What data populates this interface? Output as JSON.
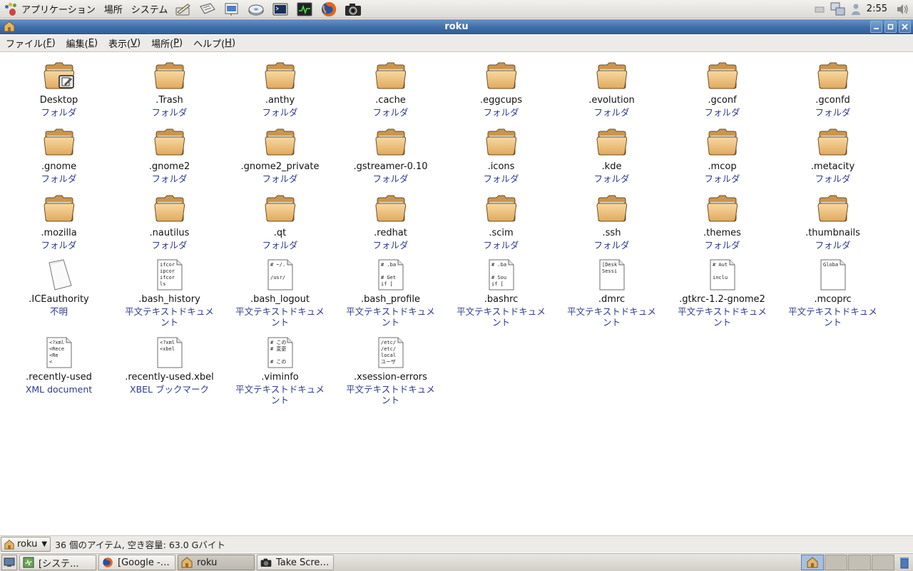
{
  "top_panel": {
    "applications_label": "アプリケーション",
    "places_label": "場所",
    "system_label": "システム",
    "launchers": [
      {
        "icon": "pen-drawing-icon"
      },
      {
        "icon": "text-editor-icon"
      },
      {
        "icon": "presentation-icon"
      },
      {
        "icon": "disk-icon"
      },
      {
        "icon": "terminal-icon"
      },
      {
        "icon": "system-monitor-icon"
      },
      {
        "icon": "firefox-icon"
      },
      {
        "icon": "camera-icon"
      }
    ],
    "clock": "2:55"
  },
  "window": {
    "title": "roku"
  },
  "menubar": {
    "items": [
      {
        "label": "ファイル(",
        "accel": "F",
        "close": ")"
      },
      {
        "label": "編集(",
        "accel": "E",
        "close": ")"
      },
      {
        "label": "表示(",
        "accel": "V",
        "close": ")"
      },
      {
        "label": "場所(",
        "accel": "P",
        "close": ")"
      },
      {
        "label": "ヘルプ(",
        "accel": "H",
        "close": ")"
      }
    ]
  },
  "icons": [
    {
      "name": "Desktop",
      "type": "フォルダ",
      "kind": "desktop-folder"
    },
    {
      "name": ".Trash",
      "type": "フォルダ",
      "kind": "folder"
    },
    {
      "name": ".anthy",
      "type": "フォルダ",
      "kind": "folder"
    },
    {
      "name": ".cache",
      "type": "フォルダ",
      "kind": "folder"
    },
    {
      "name": ".eggcups",
      "type": "フォルダ",
      "kind": "folder"
    },
    {
      "name": ".evolution",
      "type": "フォルダ",
      "kind": "folder"
    },
    {
      "name": ".gconf",
      "type": "フォルダ",
      "kind": "folder"
    },
    {
      "name": ".gconfd",
      "type": "フォルダ",
      "kind": "folder"
    },
    {
      "name": ".gnome",
      "type": "フォルダ",
      "kind": "folder"
    },
    {
      "name": ".gnome2",
      "type": "フォルダ",
      "kind": "folder"
    },
    {
      "name": ".gnome2_private",
      "type": "フォルダ",
      "kind": "folder"
    },
    {
      "name": ".gstreamer-0.10",
      "type": "フォルダ",
      "kind": "folder"
    },
    {
      "name": ".icons",
      "type": "フォルダ",
      "kind": "folder"
    },
    {
      "name": ".kde",
      "type": "フォルダ",
      "kind": "folder"
    },
    {
      "name": ".mcop",
      "type": "フォルダ",
      "kind": "folder"
    },
    {
      "name": ".metacity",
      "type": "フォルダ",
      "kind": "folder"
    },
    {
      "name": ".mozilla",
      "type": "フォルダ",
      "kind": "folder"
    },
    {
      "name": ".nautilus",
      "type": "フォルダ",
      "kind": "folder"
    },
    {
      "name": ".qt",
      "type": "フォルダ",
      "kind": "folder"
    },
    {
      "name": ".redhat",
      "type": "フォルダ",
      "kind": "folder"
    },
    {
      "name": ".scim",
      "type": "フォルダ",
      "kind": "folder"
    },
    {
      "name": ".ssh",
      "type": "フォルダ",
      "kind": "folder"
    },
    {
      "name": ".themes",
      "type": "フォルダ",
      "kind": "folder"
    },
    {
      "name": ".thumbnails",
      "type": "フォルダ",
      "kind": "folder"
    },
    {
      "name": ".ICEauthority",
      "type": "不明",
      "kind": "blank-file"
    },
    {
      "name": ".bash_history",
      "type": "平文テキストドキュメント",
      "kind": "text-file",
      "preview": [
        "ifcor",
        "ipcor",
        "ifcor",
        "ls"
      ]
    },
    {
      "name": ".bash_logout",
      "type": "平文テキストドキュメント",
      "kind": "text-file",
      "preview": [
        "# ~/.",
        "",
        "/usr/",
        ""
      ]
    },
    {
      "name": ".bash_profile",
      "type": "平文テキストドキュメント",
      "kind": "text-file",
      "preview": [
        "# .ba",
        "",
        "# Get",
        "if ["
      ]
    },
    {
      "name": ".bashrc",
      "type": "平文テキストドキュメント",
      "kind": "text-file",
      "preview": [
        "# .ba",
        "",
        "# Sou",
        "if ["
      ]
    },
    {
      "name": ".dmrc",
      "type": "平文テキストドキュメント",
      "kind": "text-file",
      "preview": [
        "[Desk",
        "Sessi",
        "",
        ""
      ]
    },
    {
      "name": ".gtkrc-1.2-gnome2",
      "type": "平文テキストドキュメント",
      "kind": "text-file",
      "preview": [
        "# Aut",
        "",
        "inclu",
        ""
      ]
    },
    {
      "name": ".mcoprc",
      "type": "平文テキストドキュメント",
      "kind": "text-file",
      "preview": [
        "Globa",
        "",
        "",
        ""
      ]
    },
    {
      "name": ".recently-used",
      "type": "XML document",
      "kind": "text-file",
      "preview": [
        "<?xml",
        "<Rece",
        "  <Re",
        "    <"
      ]
    },
    {
      "name": ".recently-used.xbel",
      "type": "XBEL ブックマーク",
      "kind": "text-file",
      "preview": [
        "<?xml",
        "<xbel",
        "",
        ""
      ]
    },
    {
      "name": ".viminfo",
      "type": "平文テキストドキュメント",
      "kind": "text-file",
      "preview": [
        "# この",
        "# 変更",
        "",
        "# この"
      ]
    },
    {
      "name": ".xsession-errors",
      "type": "平文テキストドキュメント",
      "kind": "text-file",
      "preview": [
        "/etc/",
        "/etc/",
        "local",
        "ユーザ"
      ]
    }
  ],
  "statusbar": {
    "location": "roku",
    "summary": "36 個のアイテム, 空き容量: 63.0 Gバイト"
  },
  "taskbar": {
    "tasks": [
      {
        "label": "[システ...",
        "icon": "system-monitor-icon",
        "active": false
      },
      {
        "label": "[Google -…",
        "icon": "firefox-icon",
        "active": false
      },
      {
        "label": "roku",
        "icon": "home-folder-icon",
        "active": true
      },
      {
        "label": "Take Scre…",
        "icon": "camera-icon",
        "active": false
      }
    ],
    "workspaces": 4,
    "active_workspace": 1
  }
}
